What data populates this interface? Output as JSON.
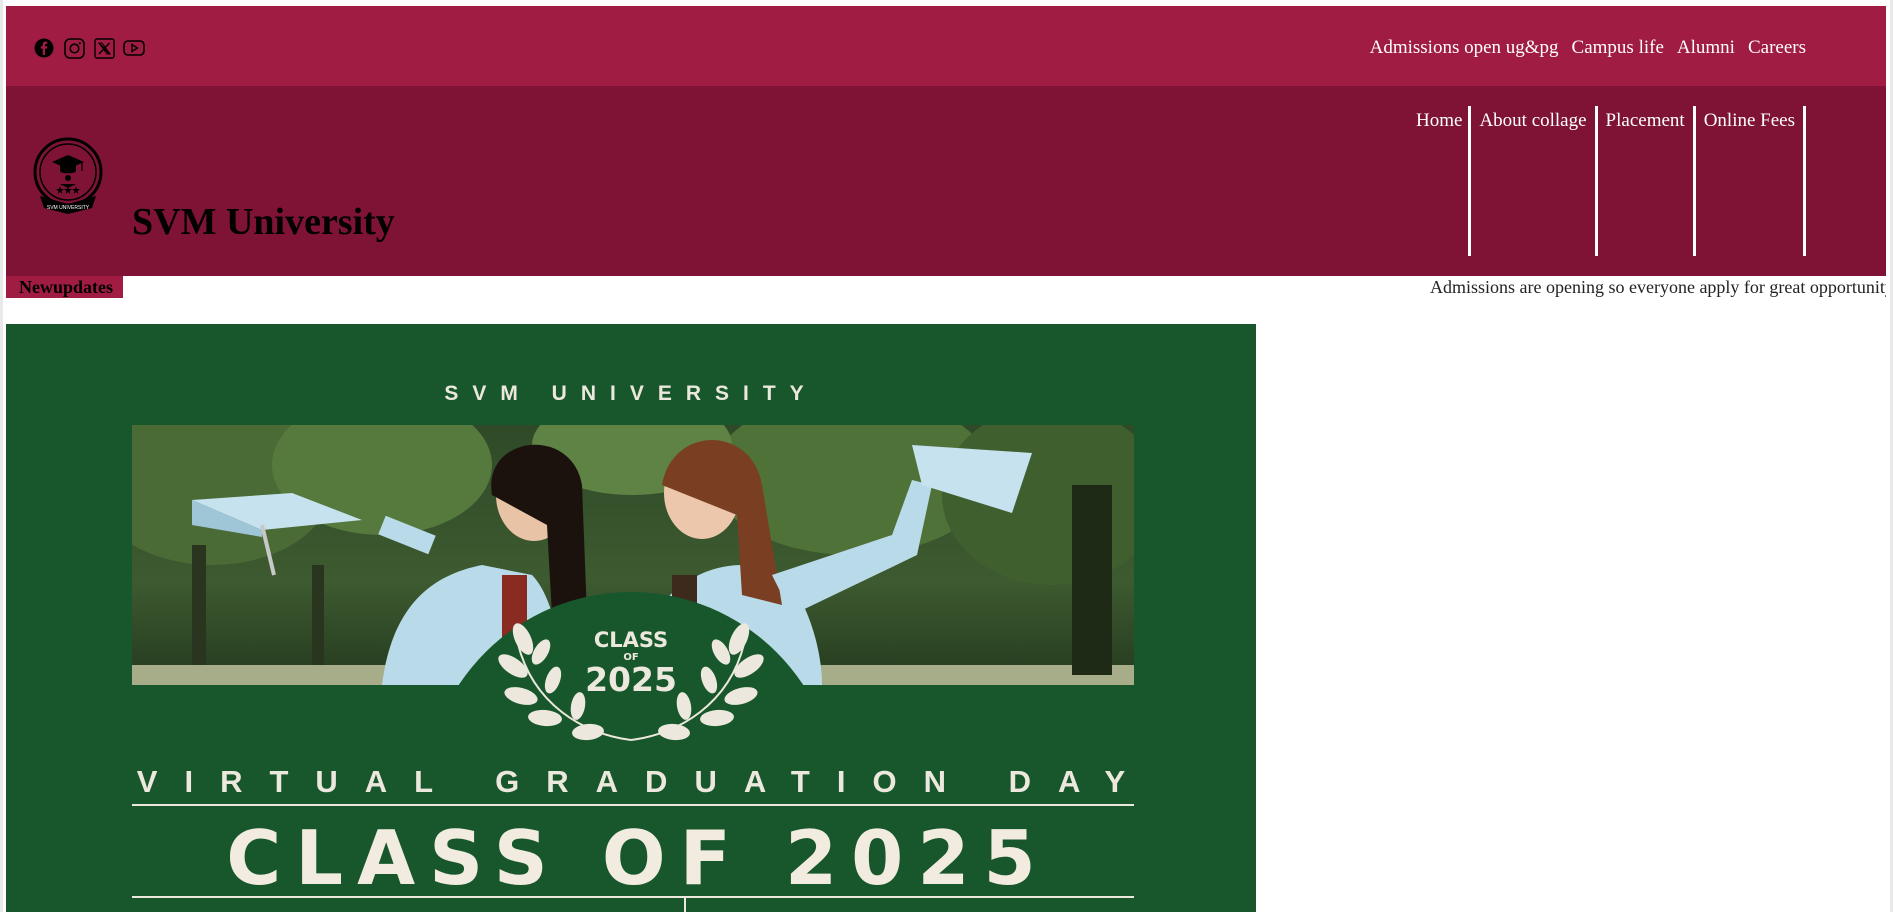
{
  "colors": {
    "topbar": "#a01c42",
    "header": "#7f1336",
    "banner": "#18572c",
    "banner_text": "#ede8dd"
  },
  "social": {
    "icons": [
      "facebook-icon",
      "instagram-icon",
      "x-twitter-icon",
      "youtube-icon"
    ]
  },
  "toplinks": {
    "admissions": "Admissions open ug&pg",
    "campus": "Campus life",
    "alumni": "Alumni",
    "careers": "Careers"
  },
  "header": {
    "brand": "SVM University",
    "logo_text": "SVM UNIVERSITY"
  },
  "nav": {
    "home": "Home",
    "about": "About collage",
    "placement": "Placement",
    "fees": "Online Fees"
  },
  "updates": {
    "label": "Newupdates",
    "ticker": "Admissions are opening so everyone apply for great opportunity"
  },
  "banner": {
    "university": "SVM UNIVERSITY",
    "class_small_1": "CLASS",
    "class_small_2": "OF",
    "class_small_3": "2025",
    "event": "VIRTUAL GRADUATION DAY",
    "headline": "CLASS OF 2025"
  }
}
